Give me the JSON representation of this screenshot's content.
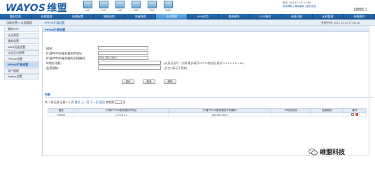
{
  "header": {
    "logo_en": "WAYOS",
    "logo_cn": "维盟",
    "ports": [
      "LAN",
      "LAN",
      "LAN",
      "LAN",
      "LAN",
      "WAN"
    ],
    "info_line1": "版本: 2020.10.3 v7.13.480",
    "info_line2": "系统帮助 | 清除缓存 | 退出系统",
    "lang": "简体中文"
  },
  "nav": {
    "items": [
      "路由状态",
      "系统管理",
      "网络配置",
      "智能流控",
      "设备管理",
      "认证管理",
      "VPN应用",
      "路由模块",
      "ESS服务",
      "高级功能",
      "无线管理",
      "系统维护"
    ],
    "active_index": 5
  },
  "crumb": {
    "path": "当前位置 > 认证管理",
    "page": "PPPoE扩展设置"
  },
  "sys_time": "系统时间: 2017-11-10 17:26:15",
  "sidebar": {
    "items": [
      "我的WiFi",
      "认证类型",
      "服务设置",
      "WEB页面设置",
      "认证后台配置",
      "PPPoE设置",
      "PPPoE扩展设置",
      "用户管理",
      "Radius设置"
    ],
    "active_index": 6
  },
  "panel": {
    "title": "PPPoE扩展设置"
  },
  "form": {
    "rows": [
      {
        "label": "描述:",
        "value": ""
      },
      {
        "label": "扩展PPPoE服务器的IP地址:",
        "value": ""
      },
      {
        "label": "扩展PPPoE服务器的子网掩码:",
        "value": "255.255.255.0"
      },
      {
        "label": "IP地址池段:",
        "value": "",
        "hint": "(以英文逗号\",\"分隔,最多填写25个IP地址段,格式:1.1.1.1-1.1.1.10)"
      },
      {
        "label": "连接限制:",
        "value": "",
        "hint": "(为空/0表示不限制)"
      }
    ],
    "buttons": [
      "保存",
      "取消",
      "清除"
    ]
  },
  "list": {
    "title": "列表",
    "pager_text": "共 1 条记录  当前 1/1 页",
    "pager_links": [
      "首页",
      "上一页",
      "下一页",
      "尾页"
    ],
    "goto_text": "转到第",
    "goto_suffix": "页",
    "columns": [
      "描述",
      "扩展PPPoE服务器的IP地址",
      "扩展PPPoE服务器的子网掩码",
      "IP地址池段",
      "连接限制",
      "操作"
    ],
    "rows": [
      [
        "Default",
        "172.16.1.1",
        "255.255.255.0",
        "",
        "",
        ""
      ]
    ]
  },
  "watermark": {
    "text": "维盟科技"
  }
}
